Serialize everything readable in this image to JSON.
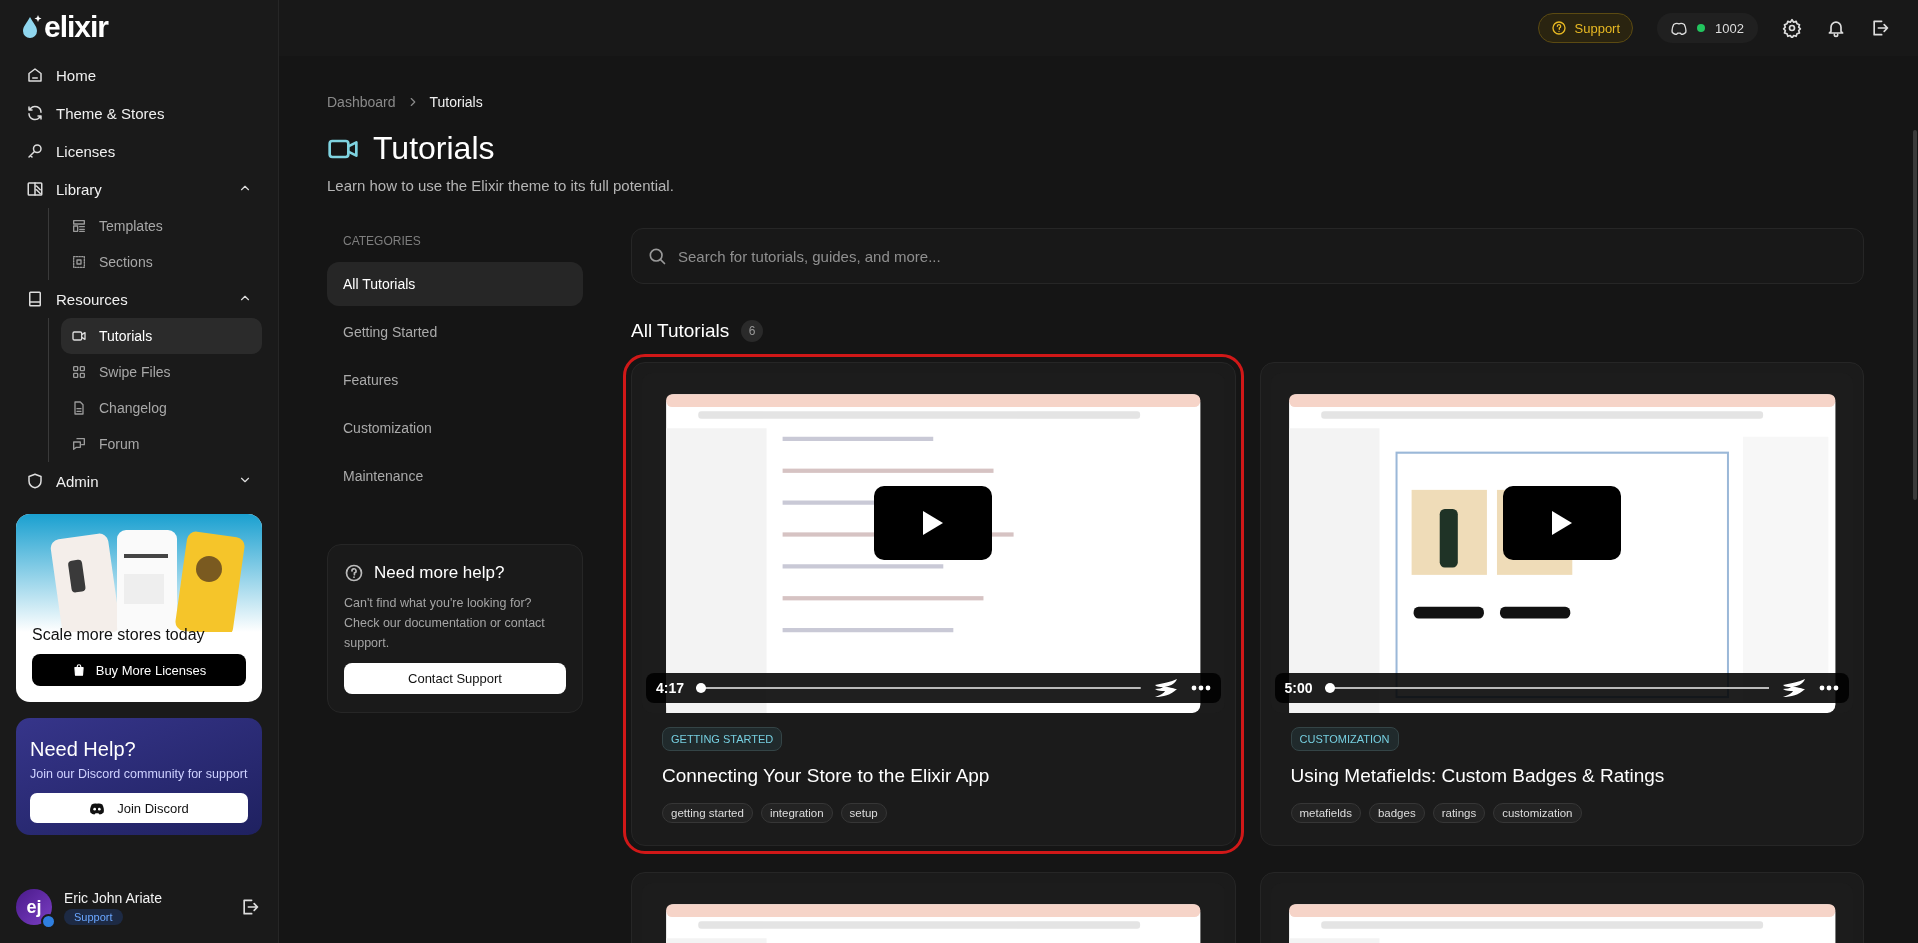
{
  "sidebar": {
    "logo": "elixir",
    "nav": [
      {
        "label": "Home",
        "selected": false
      },
      {
        "label": "Theme & Stores",
        "selected": false
      },
      {
        "label": "Licenses",
        "selected": false
      },
      {
        "label": "Library",
        "selected": false,
        "expanded": true,
        "children": [
          {
            "label": "Templates",
            "selected": false
          },
          {
            "label": "Sections",
            "selected": false
          }
        ]
      },
      {
        "label": "Resources",
        "selected": false,
        "expanded": true,
        "children": [
          {
            "label": "Tutorials",
            "selected": true
          },
          {
            "label": "Swipe Files",
            "selected": false
          },
          {
            "label": "Changelog",
            "selected": false
          },
          {
            "label": "Forum",
            "selected": false
          }
        ]
      },
      {
        "label": "Admin",
        "selected": false,
        "expanded": false
      }
    ],
    "promo": {
      "title": "Scale more stores today",
      "button": "Buy More Licenses"
    },
    "help": {
      "title": "Need Help?",
      "text": "Join our Discord community for support",
      "button": "Join Discord"
    },
    "user": {
      "initials": "ej",
      "name": "Eric John Ariate",
      "role": "Support"
    }
  },
  "topbar": {
    "support": "Support",
    "discord_count": "1002"
  },
  "breadcrumb": [
    "Dashboard",
    "Tutorials"
  ],
  "page": {
    "title": "Tutorials",
    "subtitle": "Learn how to use the Elixir theme to its full potential."
  },
  "categories": {
    "heading": "CATEGORIES",
    "items": [
      {
        "label": "All Tutorials",
        "selected": true
      },
      {
        "label": "Getting Started",
        "selected": false
      },
      {
        "label": "Features",
        "selected": false
      },
      {
        "label": "Customization",
        "selected": false
      },
      {
        "label": "Maintenance",
        "selected": false
      }
    ]
  },
  "help_card": {
    "title": "Need more help?",
    "text": "Can't find what you're looking for? Check our documentation or contact support.",
    "button": "Contact Support"
  },
  "search": {
    "placeholder": "Search for tutorials, guides, and more..."
  },
  "section": {
    "title": "All Tutorials",
    "count": "6"
  },
  "tutorials": [
    {
      "highlighted": true,
      "duration": "4:17",
      "level": 0,
      "category": "GETTING STARTED",
      "title": "Connecting Your Store to the Elixir App",
      "tags": [
        "getting started",
        "integration",
        "setup"
      ]
    },
    {
      "highlighted": false,
      "duration": "5:00",
      "level": 0,
      "category": "CUSTOMIZATION",
      "title": "Using Metafields: Custom Badges & Ratings",
      "tags": [
        "metafields",
        "badges",
        "ratings",
        "customization"
      ]
    },
    {
      "highlighted": false
    },
    {
      "highlighted": false
    }
  ]
}
